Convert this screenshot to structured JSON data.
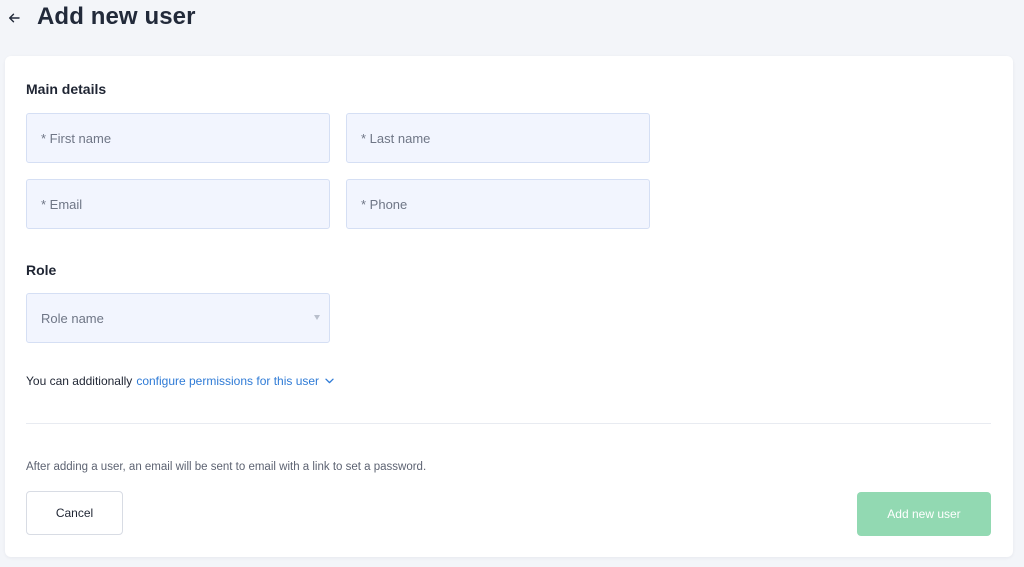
{
  "header": {
    "back_icon": "arrow-left-icon",
    "title": "Add new user"
  },
  "main_details": {
    "title": "Main details",
    "first_name": {
      "placeholder": "* First name",
      "value": ""
    },
    "last_name": {
      "placeholder": "* Last name",
      "value": ""
    },
    "email": {
      "placeholder": "* Email",
      "value": ""
    },
    "phone": {
      "placeholder": "* Phone",
      "value": ""
    }
  },
  "role": {
    "title": "Role",
    "select_placeholder": "Role name",
    "caret_icon": "caret-down-icon"
  },
  "permissions": {
    "prefix": "You can additionally",
    "link_text": "configure permissions for this user",
    "chevron_icon": "chevron-down-icon"
  },
  "footer": {
    "note": "After adding a user, an email will be sent to email with a link to set a password.",
    "cancel_label": "Cancel",
    "add_label": "Add new user"
  },
  "colors": {
    "page_background": "#f3f5f9",
    "card_background": "#ffffff",
    "field_background": "#f2f5fe",
    "field_border": "#d5dff4",
    "link": "#2f7bd6",
    "primary_button_disabled": "#92d9b2",
    "title_text": "#222a3a"
  }
}
